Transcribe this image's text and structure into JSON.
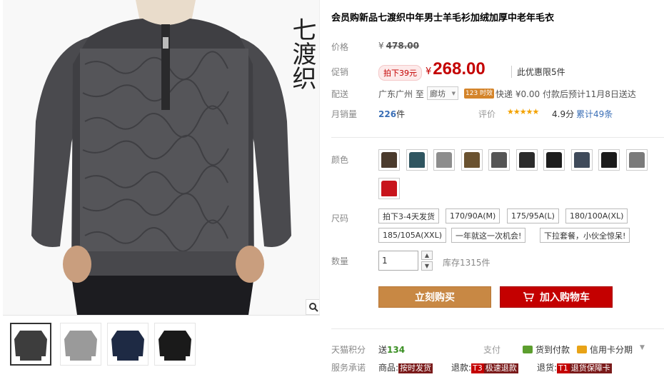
{
  "gallery": {
    "brand_mark": "七渡织",
    "zoom_icon": "magnifier-icon",
    "thumbnails": [
      {
        "color": "#3d3d3d",
        "active": true
      },
      {
        "color": "#9a9a9a",
        "active": false
      },
      {
        "color": "#1e2a44",
        "active": false
      },
      {
        "color": "#1a1a1a",
        "active": false
      }
    ]
  },
  "product": {
    "title": "会员购新品七渡织中年男士羊毛衫加绒加厚中老年毛衣"
  },
  "price": {
    "label": "价格",
    "currency": "¥",
    "original": "478.00"
  },
  "promo": {
    "label": "促销",
    "badge": "拍下39元",
    "currency": "¥",
    "price": "268.00",
    "limit": "此优惠限5件"
  },
  "shipping": {
    "label": "配送",
    "from": "广东广州 至",
    "to": "廊坊",
    "badge": "123 时效",
    "info": "快递 ¥0.00 付款后预计11月8日送达"
  },
  "sales": {
    "label": "月销量",
    "value": "226",
    "unit": "件",
    "rating_label": "评价",
    "stars": "★★★★★",
    "score": "4.9分",
    "reviews": "累计49条"
  },
  "colors": {
    "label": "颜色",
    "swatches": [
      "#4a3a2c",
      "#2f5560",
      "#8d8d8d",
      "#6a5230",
      "#555555",
      "#2b2b2b",
      "#1d1d1d",
      "#3f4a5a",
      "#1b1b1b",
      "#7a7a7a",
      "#c8141c"
    ]
  },
  "sizes": {
    "label": "尺码",
    "options": [
      "拍下3-4天发货",
      "170/90A(M)",
      "175/95A(L)",
      "180/100A(XL)",
      "185/105A(XXL)",
      "一年就这一次机会!",
      "下拉套餐，小伙全惊呆!"
    ]
  },
  "quantity": {
    "label": "数量",
    "value": "1",
    "stock": "库存1315件"
  },
  "actions": {
    "buy": "立刻购买",
    "cart": "加入购物车"
  },
  "points": {
    "label": "天猫积分",
    "prefix": "送",
    "value": "134"
  },
  "payment": {
    "label": "支付",
    "cod": "货到付款",
    "installment": "信用卡分期",
    "accent_cod": "#5c9e2e",
    "accent_card": "#e8a317"
  },
  "services": {
    "label": "服务承诺",
    "items": [
      {
        "prefix": "商品:",
        "tag": "按时发货"
      },
      {
        "prefix": "退款:",
        "tag_code": "T3",
        "tag": "极速退款"
      },
      {
        "prefix": "退货:",
        "tag_code": "T1",
        "tag": "退货保障卡"
      }
    ]
  },
  "accent": {
    "price_red": "#c40000",
    "buy_orange": "#c88844",
    "link_blue": "#3b6fb6"
  }
}
